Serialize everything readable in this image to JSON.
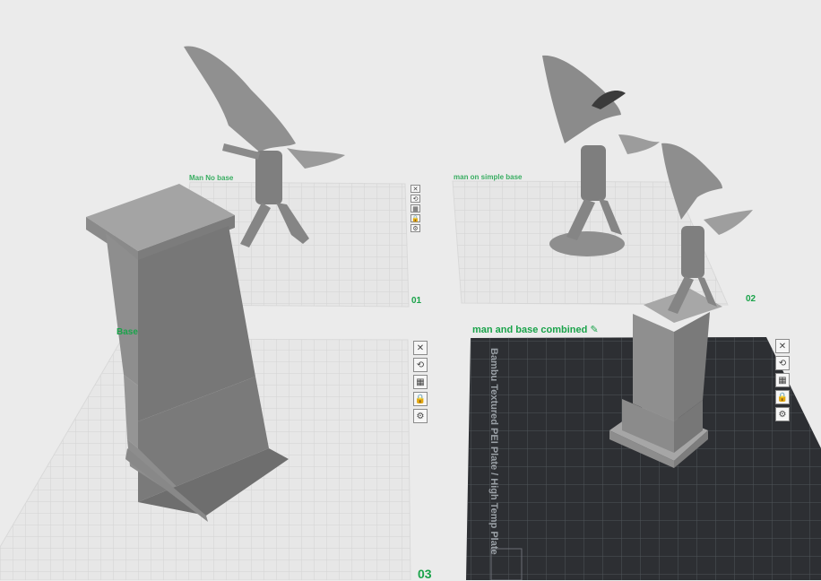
{
  "plates": [
    {
      "id": "01",
      "label": "Man No base",
      "number": "01"
    },
    {
      "id": "02",
      "label": "man on simple base",
      "number": "02"
    },
    {
      "id": "03",
      "label": "Base",
      "number": "03"
    },
    {
      "id": "04",
      "label": "man and base combined",
      "number": ""
    }
  ],
  "build_plate_text": "Bambu Textured PEI Plate / High Temp Plate",
  "plate_tools": [
    "close-icon",
    "auto-orient-icon",
    "arrange-icon",
    "lock-icon",
    "settings-icon"
  ],
  "tool_glyphs": [
    "✕",
    "⟲",
    "▦",
    "🔒",
    "⚙"
  ],
  "colors": {
    "background": "#ebebeb",
    "plate_surface": "#e7e7e7",
    "grid_line": "#d2d2d2",
    "active_plate": "#2d2f33",
    "active_grid": "#44474c",
    "label_green": "#1aa34a",
    "model_gray": "#8f8f8f"
  }
}
